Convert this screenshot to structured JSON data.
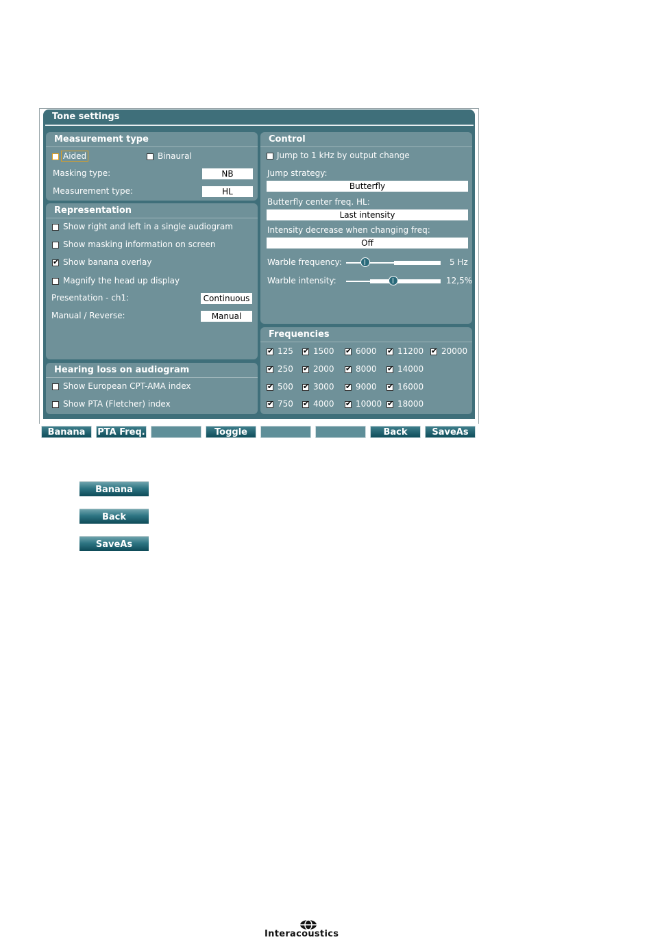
{
  "window_title": "Tone settings",
  "measurement_type": {
    "header": "Measurement type",
    "aided_label": "Aided",
    "aided_checked": false,
    "binaural_label": "Binaural",
    "binaural_checked": false,
    "masking_type_label": "Masking type:",
    "masking_type_value": "NB",
    "measurement_type_label": "Measurement type:",
    "measurement_type_value": "HL"
  },
  "representation": {
    "header": "Representation",
    "options": [
      {
        "label": "Show right and left in a single audiogram",
        "checked": false
      },
      {
        "label": "Show masking information on screen",
        "checked": false
      },
      {
        "label": "Show banana overlay",
        "checked": true
      },
      {
        "label": "Magnify the head up display",
        "checked": false
      }
    ],
    "presentation_label": "Presentation - ch1:",
    "presentation_value": "Continuous",
    "manual_reverse_label": "Manual / Reverse:",
    "manual_reverse_value": "Manual"
  },
  "hearing_loss": {
    "header": "Hearing loss on audiogram",
    "options": [
      {
        "label": "Show European CPT-AMA index",
        "checked": false
      },
      {
        "label": "Show PTA (Fletcher) index",
        "checked": false
      }
    ]
  },
  "control": {
    "header": "Control",
    "jump_label": "Jump to 1 kHz by output change",
    "jump_checked": false,
    "jump_strategy_label": "Jump strategy:",
    "jump_strategy_value": "Butterfly",
    "butterfly_label": "Butterfly center freq. HL:",
    "butterfly_value": "Last intensity",
    "intensity_label": "Intensity decrease when changing freq:",
    "intensity_value": "Off",
    "warble_freq_label": "Warble frequency:",
    "warble_freq_value": "5 Hz",
    "warble_freq_level": 0.2,
    "warble_int_label": "Warble intensity:",
    "warble_int_value": "12,5%",
    "warble_int_level": 0.5
  },
  "frequencies": {
    "header": "Frequencies",
    "columns": [
      [
        "125",
        "250",
        "500",
        "750"
      ],
      [
        "1500",
        "2000",
        "3000",
        "4000"
      ],
      [
        "6000",
        "8000",
        "9000",
        "10000"
      ],
      [
        "11200",
        "14000",
        "16000",
        "18000"
      ],
      [
        "20000"
      ]
    ],
    "all_checked": true
  },
  "function_bar": [
    "Banana",
    "PTA Freq.",
    "",
    "Toggle",
    "",
    "",
    "Back",
    "SaveAs"
  ],
  "legend_buttons": [
    "Banana",
    "Back",
    "SaveAs"
  ],
  "brand": "Interacoustics"
}
